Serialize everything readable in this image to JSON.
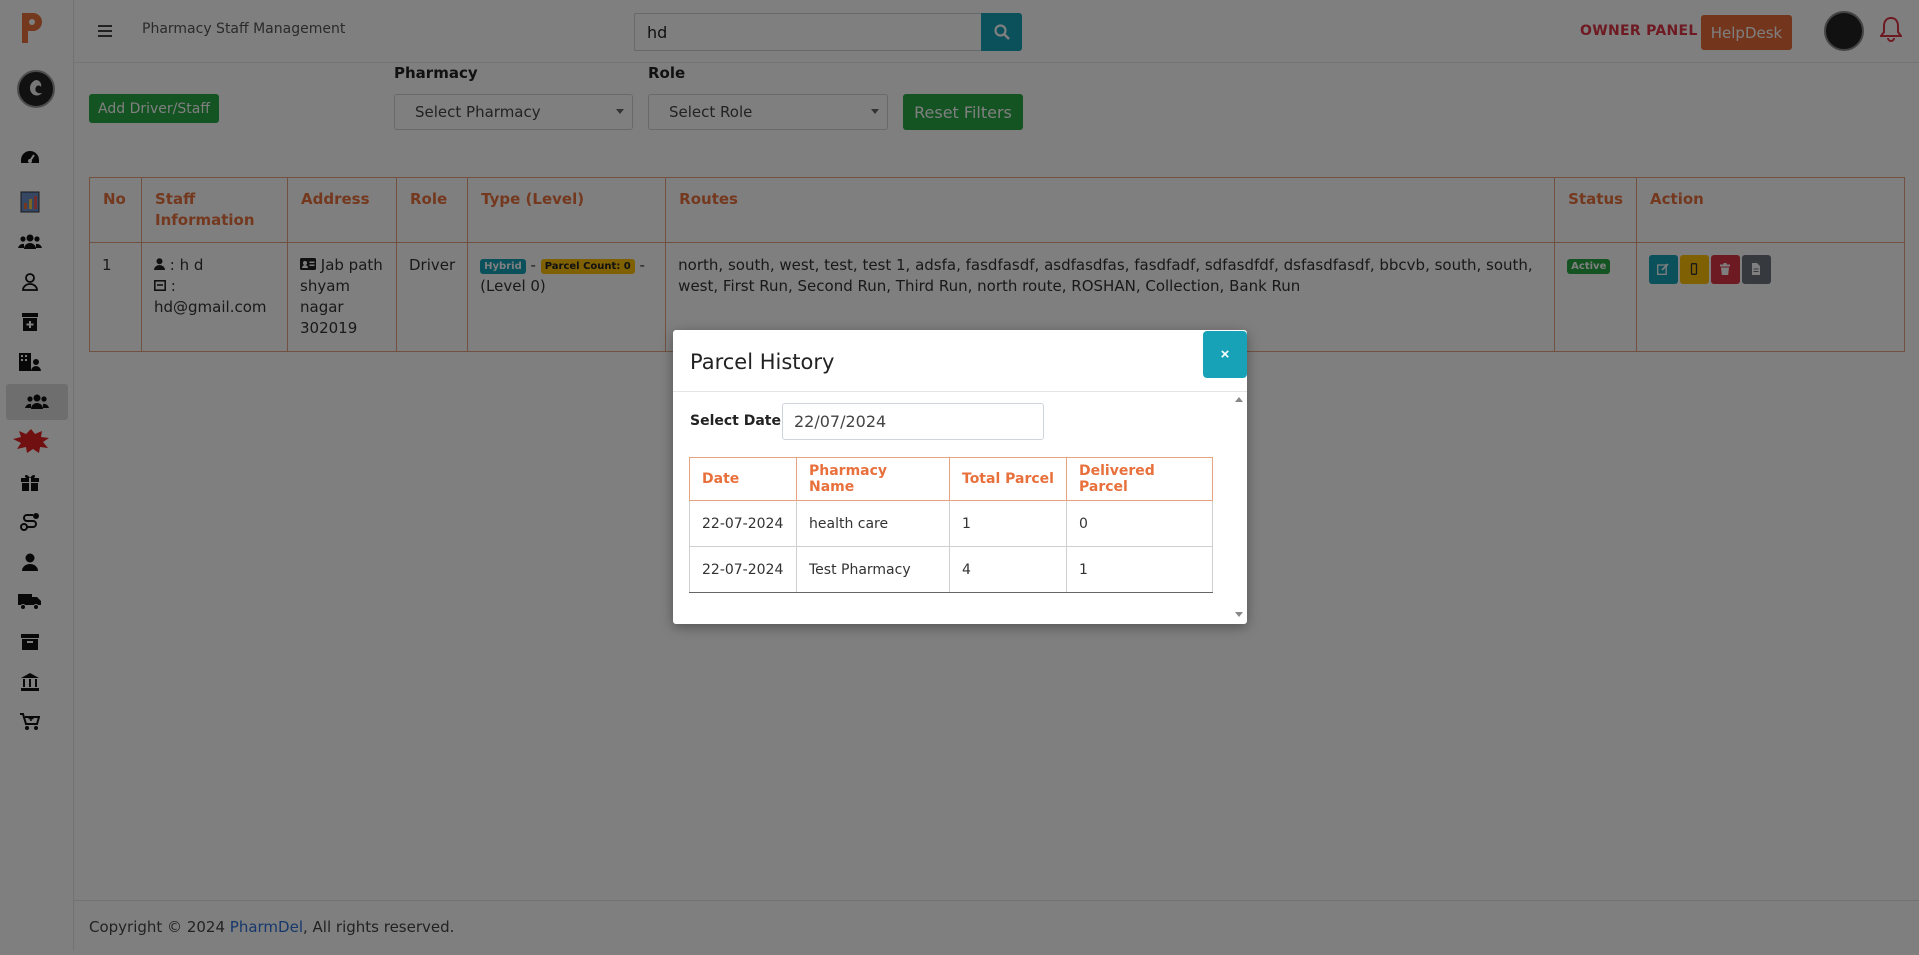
{
  "header": {
    "app_title": "Pharmacy Staff Management",
    "search_value": "hd",
    "owner_panel": "OWNER PANEL",
    "helpdesk": "HelpDesk"
  },
  "filters": {
    "add_button": "Add Driver/Staff",
    "pharmacy_label": "Pharmacy",
    "pharmacy_select": "Select Pharmacy",
    "role_label": "Role",
    "role_select": "Select Role",
    "reset_button": "Reset Filters"
  },
  "staff_table": {
    "headers": [
      "No",
      "Staff Information",
      "Address",
      "Role",
      "Type (Level)",
      "Routes",
      "Status",
      "Action"
    ],
    "rows": [
      {
        "no": "1",
        "name": ": h d",
        "email_sep": ":",
        "email": "hd@gmail.com",
        "address": "Jab path shyam nagar 302019",
        "role": "Driver",
        "type_badge": "Hybrid",
        "parcel_badge": "Parcel Count: 0",
        "level": "(Level 0)",
        "routes": "north, south, west, test, test 1, adsfa, fasdfasdf, asdfasdfas, fasdfadf, sdfasdfdf, dsfasdfasdf, bbcvb, south, south, west, First Run, Second Run, Third Run, north route, ROSHAN, Collection, Bank Run",
        "status": "Active"
      }
    ]
  },
  "footer": {
    "prefix": "Copyright © 2024 ",
    "link": "PharmDel",
    "suffix": ", All rights reserved."
  },
  "modal": {
    "title": "Parcel History",
    "close": "×",
    "date_label": "Select Date:",
    "date_value": "22/07/2024",
    "headers": [
      "Date",
      "Pharmacy Name",
      "Total Parcel",
      "Delivered Parcel"
    ],
    "rows": [
      [
        "22-07-2024",
        "health care",
        "1",
        "0"
      ],
      [
        "22-07-2024",
        "Test Pharmacy",
        "4",
        "1"
      ]
    ]
  },
  "colors": {
    "accent_orange": "#e8703c",
    "info": "#17a2b8",
    "success": "#28a745",
    "danger": "#dc3545",
    "warning": "#ffc107",
    "helpdesk": "#e96b3a"
  }
}
